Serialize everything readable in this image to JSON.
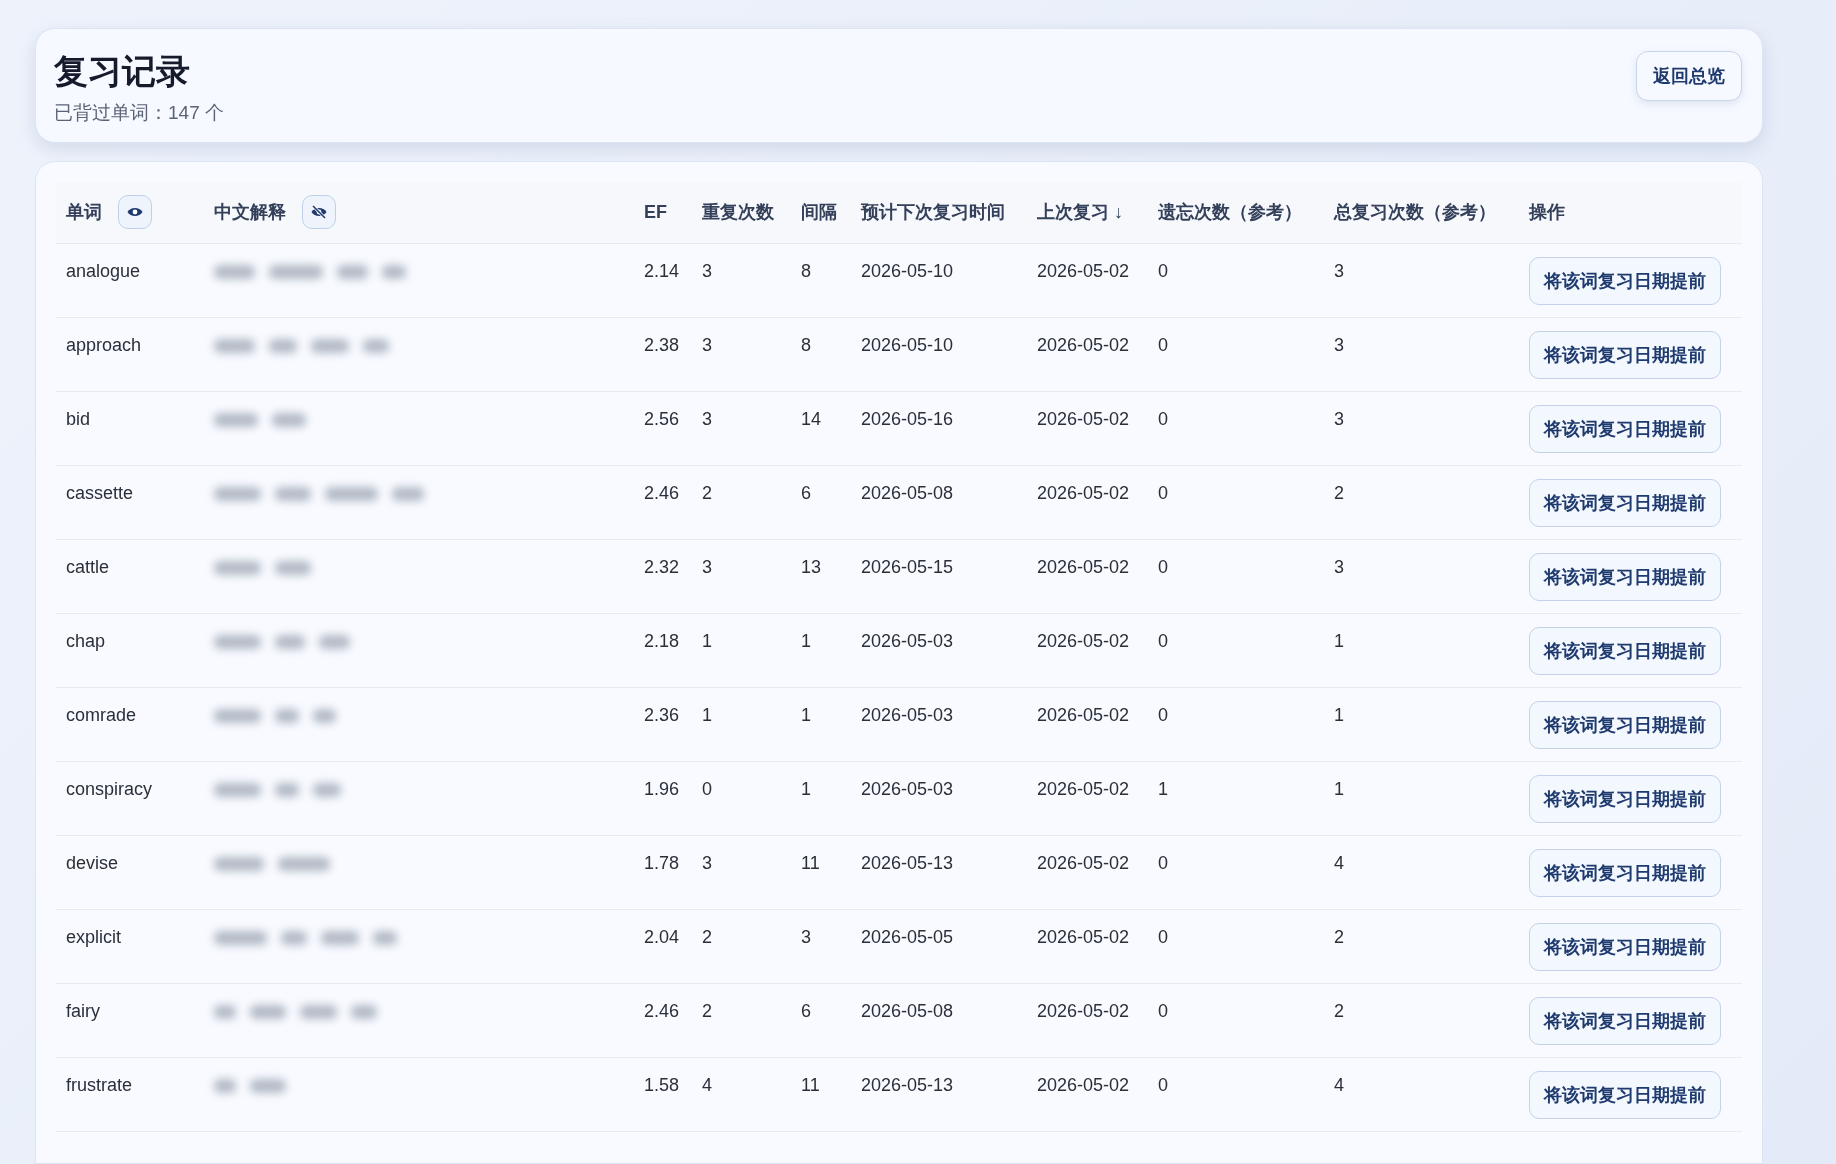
{
  "header": {
    "title": "复习记录",
    "subtitle": "已背过单词：147 个",
    "back_button": "返回总览"
  },
  "table": {
    "columns": [
      {
        "label": "单词",
        "kind": "toggle",
        "visible": true
      },
      {
        "label": "中文解释",
        "kind": "toggle",
        "visible": false
      },
      {
        "label": "EF",
        "kind": "plain"
      },
      {
        "label": "重复次数",
        "kind": "plain"
      },
      {
        "label": "间隔",
        "kind": "plain"
      },
      {
        "label": "预计下次复习时间",
        "kind": "plain"
      },
      {
        "label": "上次复习 ↓",
        "kind": "plain"
      },
      {
        "label": "遗忘次数（参考）",
        "kind": "plain"
      },
      {
        "label": "总复习次数（参考）",
        "kind": "plain"
      },
      {
        "label": "操作",
        "kind": "plain"
      }
    ],
    "rows": [
      {
        "word": "analogue",
        "ef": "2.14",
        "repeats": "3",
        "interval": "8",
        "next": "2026-05-10",
        "last": "2026-05-02",
        "lapses": "0",
        "total": "3",
        "action": "将该词复习日期提前"
      },
      {
        "word": "approach",
        "ef": "2.38",
        "repeats": "3",
        "interval": "8",
        "next": "2026-05-10",
        "last": "2026-05-02",
        "lapses": "0",
        "total": "3",
        "action": "将该词复习日期提前"
      },
      {
        "word": "bid",
        "ef": "2.56",
        "repeats": "3",
        "interval": "14",
        "next": "2026-05-16",
        "last": "2026-05-02",
        "lapses": "0",
        "total": "3",
        "action": "将该词复习日期提前"
      },
      {
        "word": "cassette",
        "ef": "2.46",
        "repeats": "2",
        "interval": "6",
        "next": "2026-05-08",
        "last": "2026-05-02",
        "lapses": "0",
        "total": "2",
        "action": "将该词复习日期提前"
      },
      {
        "word": "cattle",
        "ef": "2.32",
        "repeats": "3",
        "interval": "13",
        "next": "2026-05-15",
        "last": "2026-05-02",
        "lapses": "0",
        "total": "3",
        "action": "将该词复习日期提前"
      },
      {
        "word": "chap",
        "ef": "2.18",
        "repeats": "1",
        "interval": "1",
        "next": "2026-05-03",
        "last": "2026-05-02",
        "lapses": "0",
        "total": "1",
        "action": "将该词复习日期提前"
      },
      {
        "word": "comrade",
        "ef": "2.36",
        "repeats": "1",
        "interval": "1",
        "next": "2026-05-03",
        "last": "2026-05-02",
        "lapses": "0",
        "total": "1",
        "action": "将该词复习日期提前"
      },
      {
        "word": "conspiracy",
        "ef": "1.96",
        "repeats": "0",
        "interval": "1",
        "next": "2026-05-03",
        "last": "2026-05-02",
        "lapses": "1",
        "total": "1",
        "action": "将该词复习日期提前"
      },
      {
        "word": "devise",
        "ef": "1.78",
        "repeats": "3",
        "interval": "11",
        "next": "2026-05-13",
        "last": "2026-05-02",
        "lapses": "0",
        "total": "4",
        "action": "将该词复习日期提前"
      },
      {
        "word": "explicit",
        "ef": "2.04",
        "repeats": "2",
        "interval": "3",
        "next": "2026-05-05",
        "last": "2026-05-02",
        "lapses": "0",
        "total": "2",
        "action": "将该词复习日期提前"
      },
      {
        "word": "fairy",
        "ef": "2.46",
        "repeats": "2",
        "interval": "6",
        "next": "2026-05-08",
        "last": "2026-05-02",
        "lapses": "0",
        "total": "2",
        "action": "将该词复习日期提前"
      },
      {
        "word": "frustrate",
        "ef": "1.58",
        "repeats": "4",
        "interval": "11",
        "next": "2026-05-13",
        "last": "2026-05-02",
        "lapses": "0",
        "total": "4",
        "action": "将该词复习日期提前"
      }
    ]
  }
}
